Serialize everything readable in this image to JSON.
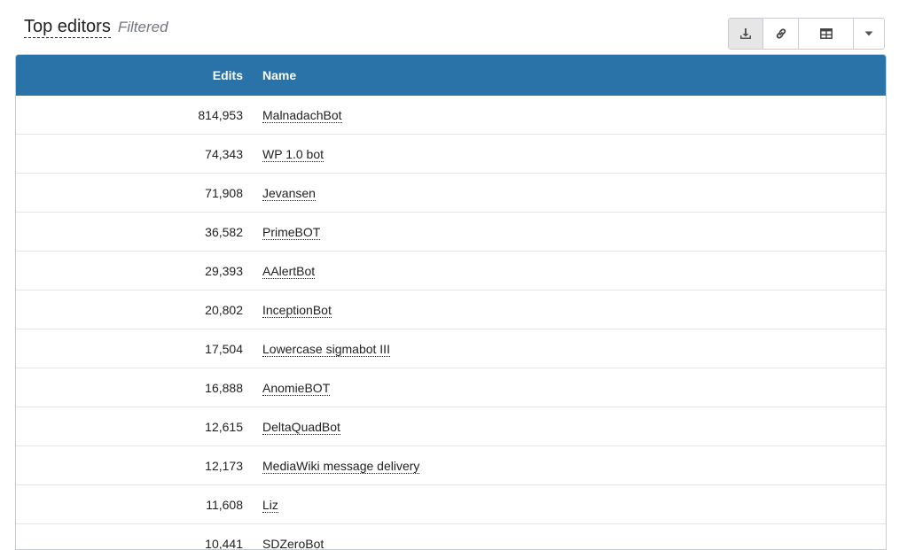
{
  "header": {
    "title": "Top editors",
    "subtitle": "Filtered"
  },
  "toolbar": {
    "icons": [
      "download-icon",
      "link-icon",
      "table-icon",
      "caret-down-icon"
    ]
  },
  "table": {
    "columns": [
      "Edits",
      "Name"
    ],
    "rows": [
      {
        "edits": "814,953",
        "name": "MalnadachBot"
      },
      {
        "edits": "74,343",
        "name": "WP 1.0 bot"
      },
      {
        "edits": "71,908",
        "name": "Jevansen"
      },
      {
        "edits": "36,582",
        "name": "PrimeBOT"
      },
      {
        "edits": "29,393",
        "name": "AAlertBot"
      },
      {
        "edits": "20,802",
        "name": "InceptionBot"
      },
      {
        "edits": "17,504",
        "name": "Lowercase sigmabot III"
      },
      {
        "edits": "16,888",
        "name": "AnomieBOT"
      },
      {
        "edits": "12,615",
        "name": "DeltaQuadBot"
      },
      {
        "edits": "12,173",
        "name": "MediaWiki message delivery"
      },
      {
        "edits": "11,608",
        "name": "Liz"
      },
      {
        "edits": "10,441",
        "name": "SDZeroBot"
      }
    ]
  },
  "colors": {
    "header_bg": "#2a73a8",
    "header_text": "#ffffff",
    "muted": "#72777d"
  }
}
